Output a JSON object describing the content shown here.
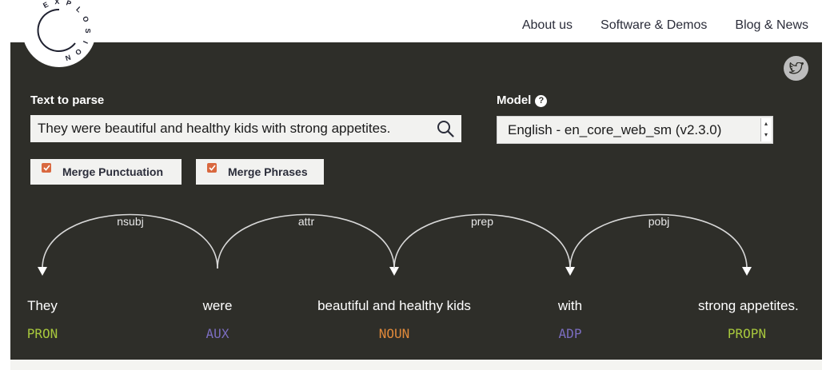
{
  "brand": {
    "logo_letters": "EXPLOSION"
  },
  "nav": {
    "items": [
      "About us",
      "Software & Demos",
      "Blog & News"
    ]
  },
  "form": {
    "text_label": "Text to parse",
    "text_value": "They were beautiful and healthy kids with strong appetites.",
    "model_label": "Model",
    "model_value": "English - en_core_web_sm (v2.3.0)",
    "help_glyph": "?"
  },
  "options": [
    {
      "label": "Merge Punctuation",
      "checked": true
    },
    {
      "label": "Merge Phrases",
      "checked": true
    }
  ],
  "parse": {
    "words": [
      {
        "text": "They",
        "tag": "PRON"
      },
      {
        "text": "were",
        "tag": "AUX"
      },
      {
        "text": "beautiful and healthy kids",
        "tag": "NOUN"
      },
      {
        "text": "with",
        "tag": "ADP"
      },
      {
        "text": "strong appetites.",
        "tag": "PROPN"
      }
    ],
    "arcs": [
      {
        "label": "nsubj",
        "start": 0,
        "end": 1,
        "dir": "left"
      },
      {
        "label": "attr",
        "start": 1,
        "end": 2,
        "dir": "right"
      },
      {
        "label": "prep",
        "start": 2,
        "end": 3,
        "dir": "right"
      },
      {
        "label": "pobj",
        "start": 3,
        "end": 4,
        "dir": "right"
      }
    ]
  },
  "colors": {
    "panel_bg": "#2e2e29",
    "checkbox": "#d9683f",
    "tag_PRON": "#a7c73d",
    "tag_AUX": "#7b6dbf",
    "tag_NOUN": "#e0893a",
    "tag_ADP": "#7b6dbf",
    "tag_PROPN": "#a7c73d"
  }
}
